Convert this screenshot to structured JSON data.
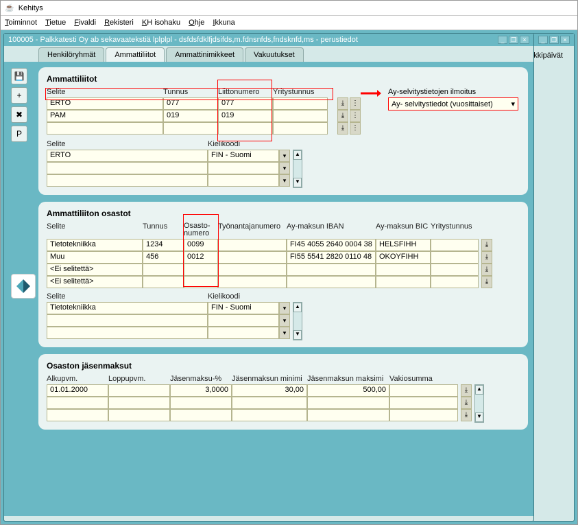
{
  "window_title": "Kehitys",
  "menubar": [
    "Toiminnot",
    "Tietue",
    "Fivaldi",
    "Rekisteri",
    "KH isohaku",
    "Ohje",
    "Ikkuna"
  ],
  "menubar_hotkeys": [
    "T",
    "T",
    "F",
    "R",
    "K",
    "O",
    "I"
  ],
  "inner_title": "100005 - Palkkatesti Oy ab sekavaatekstiä lplplpl - dsfdsfdklfjdsifds,m.fdnsnfds,fndsknfd,ms - perustiedot",
  "tabs": [
    "Henkilöryhmät",
    "Ammattiliitot",
    "Ammattinimikkeet",
    "Vakuutukset"
  ],
  "tab_right": "rkkipäivät",
  "toolbar_p": "P",
  "panel1": {
    "title": "Ammattiliitot",
    "headers": [
      "Selite",
      "Tunnus",
      "Liittonumero",
      "Yritystunnus"
    ],
    "rows": [
      {
        "selite": "ERTO",
        "tunnus": "077",
        "liitto": "077",
        "yt": ""
      },
      {
        "selite": "PAM",
        "tunnus": "019",
        "liitto": "019",
        "yt": ""
      },
      {
        "selite": "",
        "tunnus": "",
        "liitto": "",
        "yt": ""
      }
    ],
    "ay_label": "Ay-selvitystietojen ilmoitus",
    "ay_value": "Ay- selvitystiedot (vuosittaiset)",
    "sub_headers": [
      "Selite",
      "Kielikoodi"
    ],
    "sub_rows": [
      {
        "selite": "ERTO",
        "kieli": "FIN - Suomi"
      },
      {
        "selite": "",
        "kieli": ""
      },
      {
        "selite": "",
        "kieli": ""
      }
    ]
  },
  "panel2": {
    "title": "Ammattiliiton osastot",
    "headers": [
      "Selite",
      "Tunnus",
      "Osasto-\nnumero",
      "Työnantajanumero",
      "Ay-maksun IBAN",
      "Ay-maksun BIC",
      "Yritystunnus"
    ],
    "h0": "Selite",
    "h1": "Tunnus",
    "h2a": "Osasto-",
    "h2b": "numero",
    "h3": "Työnantajanumero",
    "h4": "Ay-maksun IBAN",
    "h5": "Ay-maksun BIC",
    "h6": "Yritystunnus",
    "rows": [
      {
        "selite": "Tietotekniikka",
        "tunnus": "1234",
        "osasto": "0099",
        "ta": "",
        "iban": "FI45 4055 2640 0004 38",
        "bic": "HELSFIHH",
        "yt": ""
      },
      {
        "selite": "Muu",
        "tunnus": "456",
        "osasto": "0012",
        "ta": "",
        "iban": "FI55 5541 2820 0110 48",
        "bic": "OKOYFIHH",
        "yt": ""
      },
      {
        "selite": "<Ei selitettä>",
        "tunnus": "",
        "osasto": "",
        "ta": "",
        "iban": "",
        "bic": "",
        "yt": ""
      },
      {
        "selite": "<Ei selitettä>",
        "tunnus": "",
        "osasto": "",
        "ta": "",
        "iban": "",
        "bic": "",
        "yt": ""
      }
    ],
    "sub_headers": [
      "Selite",
      "Kielikoodi"
    ],
    "sub_rows": [
      {
        "selite": "Tietotekniikka",
        "kieli": "FIN - Suomi"
      },
      {
        "selite": "",
        "kieli": ""
      },
      {
        "selite": "",
        "kieli": ""
      }
    ]
  },
  "panel3": {
    "title": "Osaston jäsenmaksut",
    "headers": [
      "Alkupvm.",
      "Loppupvm.",
      "Jäsenmaksu-%",
      "Jäsenmaksun minimi",
      "Jäsenmaksun maksimi",
      "Vakiosumma"
    ],
    "rows": [
      {
        "alku": "01.01.2000",
        "loppu": "",
        "pct": "3,0000",
        "min": "30,00",
        "max": "500,00",
        "vakio": ""
      },
      {
        "alku": "",
        "loppu": "",
        "pct": "",
        "min": "",
        "max": "",
        "vakio": ""
      },
      {
        "alku": "",
        "loppu": "",
        "pct": "",
        "min": "",
        "max": "",
        "vakio": ""
      }
    ]
  }
}
